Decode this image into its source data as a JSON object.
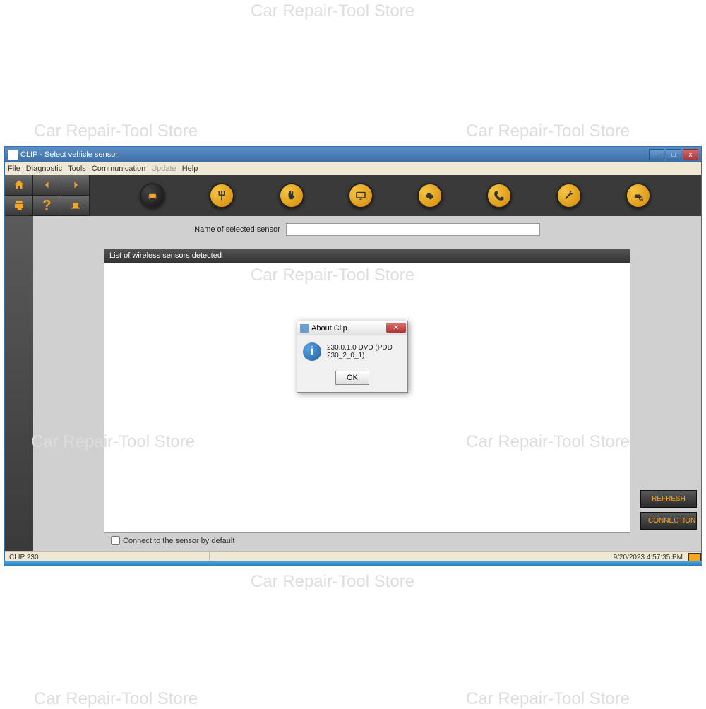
{
  "watermark_text": "Car Repair-Tool Store",
  "window": {
    "title": "CLIP - Select vehicle sensor"
  },
  "menu": {
    "file": "File",
    "diagnostic": "Diagnostic",
    "tools": "Tools",
    "communication": "Communication",
    "update": "Update",
    "help": "Help"
  },
  "toolbar": {
    "home": "home-icon",
    "back": "back-icon",
    "forward": "forward-icon",
    "print": "print-icon",
    "help": "help-icon",
    "sensor": "sensor-icon"
  },
  "main": {
    "sensor_label": "Name of selected sensor",
    "sensor_value": "",
    "list_header": "List of wireless sensors detected",
    "connect_default_label": "Connect to the sensor by default",
    "connect_default_checked": false,
    "refresh_btn": "REFRESH",
    "connection_btn": "CONNECTION"
  },
  "dialog": {
    "title": "About Clip",
    "message": "230.0.1.0 DVD (PDD 230_2_0_1)",
    "ok": "OK"
  },
  "statusbar": {
    "left": "CLIP 230",
    "right": "9/20/2023 4:57:35 PM"
  }
}
